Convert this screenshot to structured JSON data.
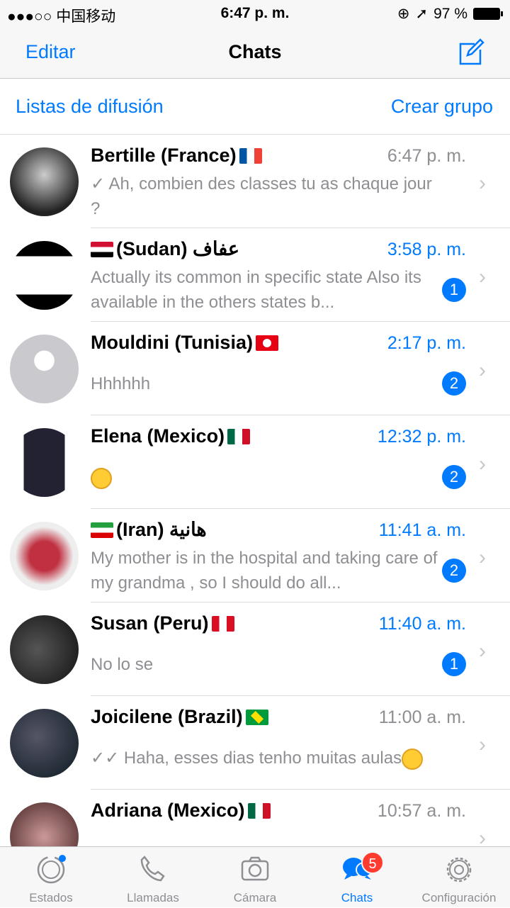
{
  "status": {
    "carrier": "●●●○○ 中国移动",
    "time": "6:47 p. m.",
    "battery": "97 %"
  },
  "nav": {
    "edit": "Editar",
    "title": "Chats",
    "compose_icon": "compose-icon"
  },
  "sub": {
    "broadcast": "Listas de difusión",
    "new_group": "Crear grupo"
  },
  "accent": "#007aff",
  "chats": [
    {
      "name": "Bertille (France)",
      "flag": "fr",
      "time": "6:47 p. m.",
      "message": "✓ Ah, combien des classes tu as chaque jour ?",
      "unread": null
    },
    {
      "name": "(Sudan) عفاف",
      "flag": "sd",
      "flag_first": true,
      "time": "3:58 p. m.",
      "message": "Actually its common in specific state Also its available in the others states b...",
      "unread": "1"
    },
    {
      "name": "Mouldini (Tunisia)",
      "flag": "tn",
      "time": "2:17 p. m.",
      "message": "Hhhhhh",
      "unread": "2"
    },
    {
      "name": "Elena (Mexico)",
      "flag": "mx",
      "time": "12:32 p. m.",
      "message": "",
      "emoji": "smiling-face-with-halo",
      "unread": "2"
    },
    {
      "name": "(Iran) هانية",
      "flag": "ir",
      "flag_first": true,
      "time": "11:41 a. m.",
      "message": "My mother is in the hospital and taking care of my grandma , so I should do all...",
      "unread": "2"
    },
    {
      "name": "Susan (Peru)",
      "flag": "pe",
      "time": "11:40 a. m.",
      "message": "No lo se",
      "unread": "1"
    },
    {
      "name": "Joicilene (Brazil)",
      "flag": "br",
      "time": "11:00 a. m.",
      "message": "✓✓ Haha, esses dias tenho muitas aulas",
      "emoji": "grinning-sweat",
      "unread": null
    },
    {
      "name": "Adriana (Mexico)",
      "flag": "mx",
      "time": "10:57 a. m.",
      "message": "",
      "unread": null
    }
  ],
  "tabs": [
    {
      "label": "Estados",
      "icon": "status-icon"
    },
    {
      "label": "Llamadas",
      "icon": "phone-icon"
    },
    {
      "label": "Cámara",
      "icon": "camera-icon"
    },
    {
      "label": "Chats",
      "icon": "chats-icon",
      "active": true,
      "badge": "5"
    },
    {
      "label": "Configuración",
      "icon": "gear-icon"
    }
  ]
}
